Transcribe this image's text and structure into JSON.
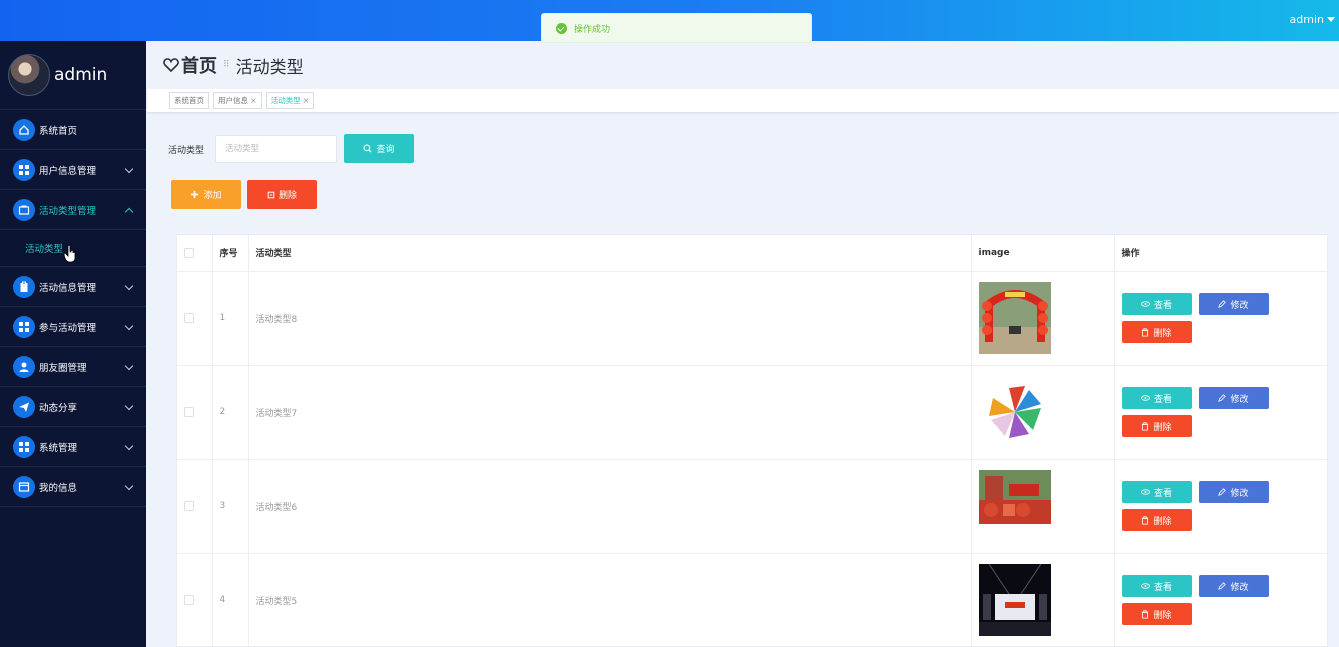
{
  "topbar": {
    "user": "admin"
  },
  "toast": {
    "message": "操作成功"
  },
  "sidebar": {
    "profile_name": "admin",
    "items": [
      {
        "label": "系统首页",
        "icon": "home-icon",
        "expandable": false
      },
      {
        "label": "用户信息管理",
        "icon": "grid-icon",
        "expandable": true
      },
      {
        "label": "活动类型管理",
        "icon": "folder-icon",
        "expandable": true,
        "active": true
      },
      {
        "label": "活动信息管理",
        "icon": "clipboard-icon",
        "expandable": true
      },
      {
        "label": "参与活动管理",
        "icon": "grid-icon",
        "expandable": true
      },
      {
        "label": "朋友圈管理",
        "icon": "user-icon",
        "expandable": true
      },
      {
        "label": "动态分享",
        "icon": "send-icon",
        "expandable": true
      },
      {
        "label": "系统管理",
        "icon": "grid-icon",
        "expandable": true
      },
      {
        "label": "我的信息",
        "icon": "window-icon",
        "expandable": true
      }
    ],
    "submenu_active": "活动类型"
  },
  "breadcrumb": {
    "home": "首页",
    "separator": "⠿",
    "current": "活动类型"
  },
  "tags": [
    {
      "label": "系统首页",
      "closable": false
    },
    {
      "label": "用户信息",
      "closable": true
    },
    {
      "label": "活动类型",
      "closable": true,
      "active": true
    }
  ],
  "search": {
    "label": "活动类型",
    "placeholder": "活动类型",
    "query_label": "查询"
  },
  "actions": {
    "add_label": "添加",
    "delete_label": "删除"
  },
  "table": {
    "headers": {
      "index": "序号",
      "name": "活动类型",
      "image": "image",
      "ops": "操作"
    },
    "rows": [
      {
        "index": "1",
        "name": "活动类型8"
      },
      {
        "index": "2",
        "name": "活动类型7"
      },
      {
        "index": "3",
        "name": "活动类型6"
      },
      {
        "index": "4",
        "name": "活动类型5"
      }
    ],
    "row_actions": {
      "view": "查看",
      "edit": "修改",
      "delete": "删除"
    }
  },
  "colors": {
    "primary": "#2ac6c6",
    "edit": "#4a73d8",
    "danger": "#f44a2a",
    "warning": "#f9a02a",
    "sidebar": "#0c1634"
  }
}
